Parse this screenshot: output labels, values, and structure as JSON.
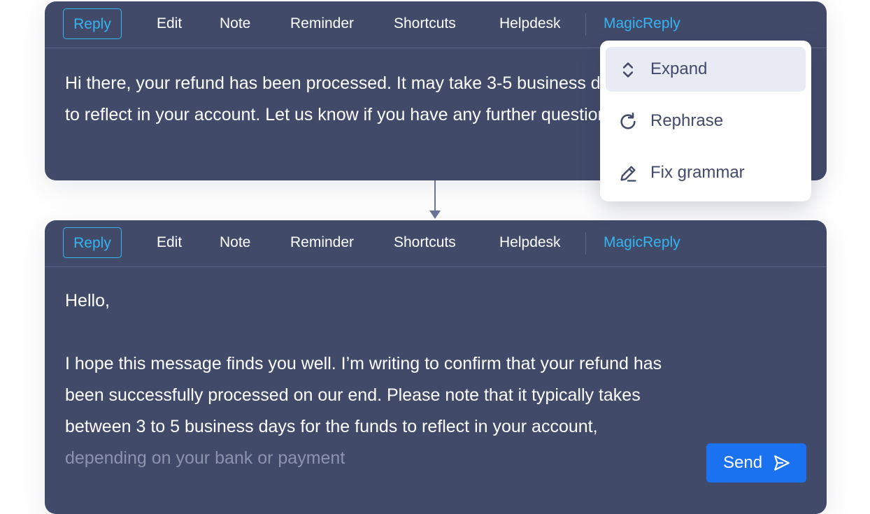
{
  "toolbar": {
    "tabs": [
      "Reply",
      "Edit",
      "Note",
      "Reminder",
      "Shortcuts",
      "Helpdesk"
    ],
    "magic_reply": "MagicReply"
  },
  "original_message": {
    "text": "Hi there, your refund has been processed. It may take 3-5 business days to reflect in your account. Let us know if you have any further questions."
  },
  "magic_menu": {
    "items": [
      {
        "label": "Expand",
        "icon": "expand-icon"
      },
      {
        "label": "Rephrase",
        "icon": "refresh-icon"
      },
      {
        "label": "Fix grammar",
        "icon": "pencil-icon"
      }
    ]
  },
  "expanded_message": {
    "greeting": "Hello,",
    "text": "I hope this message finds you well. I’m writing to confirm that your refund has been successfully processed on our end. Please note that it typically takes between 3 to 5 business days for the funds to reflect in your account,",
    "text_faded": "depending on your bank or payment"
  },
  "send": {
    "label": "Send",
    "icon": "send-icon"
  },
  "colors": {
    "panel": "#414a69",
    "accent": "#35b4f0",
    "send": "#1a72f0",
    "menu_hover": "#e9ebf4"
  }
}
